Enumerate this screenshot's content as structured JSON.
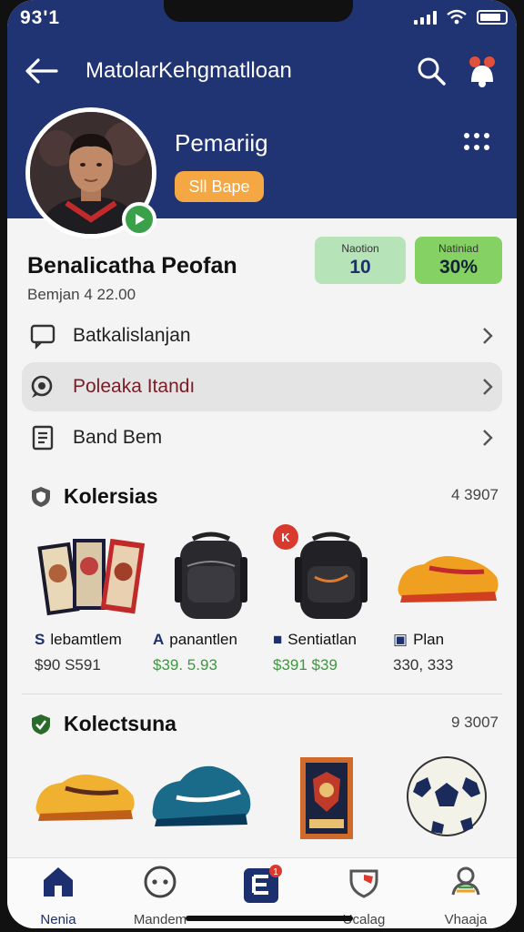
{
  "status_bar": {
    "time": "93'1"
  },
  "header": {
    "app_title": "MatolarKehgmatlloan"
  },
  "profile": {
    "role": "Pemariig",
    "badge": "Sll Bape",
    "name": "Benalicatha Peofan",
    "subtitle": "Bemjan 4 22.00",
    "stats": [
      {
        "label": "Naotion",
        "value": "10"
      },
      {
        "label": "Natiniad",
        "value": "30%"
      }
    ]
  },
  "menu": [
    {
      "label": "Batkalislanjan",
      "icon": "chat-bubble-icon"
    },
    {
      "label": "Poleaka Itandı",
      "icon": "search-chat-icon"
    },
    {
      "label": "Band Bem",
      "icon": "document-icon"
    }
  ],
  "section1": {
    "title": "Kolersias",
    "count": "4 3907",
    "items": [
      {
        "name": "lebamtlem",
        "prefix": "S",
        "price": "$90 S591",
        "price_style": "gray",
        "image": "cards"
      },
      {
        "name": "panantlen",
        "prefix": "A",
        "price": "$39. 5.93",
        "price_style": "green",
        "image": "backpack"
      },
      {
        "name": "Sentiatlan",
        "prefix": "■",
        "price": "$391 $39",
        "price_style": "green",
        "image": "backpack-orange",
        "badge": "K"
      },
      {
        "name": "Plan",
        "prefix": "▣",
        "price": "330, 333",
        "price_style": "gray",
        "image": "shoe-orange"
      }
    ]
  },
  "section2": {
    "title": "Kolectsuna",
    "count": "9 3007",
    "items": [
      {
        "image": "shoe-yellow"
      },
      {
        "image": "shoe-blue"
      },
      {
        "image": "pennant"
      },
      {
        "image": "ball"
      }
    ]
  },
  "bottom_nav": [
    {
      "label": "Nenia",
      "icon": "home-icon",
      "active": true
    },
    {
      "label": "Mandem",
      "icon": "chat-dots-icon"
    },
    {
      "label": "",
      "icon": "center-app-icon",
      "badge": "1"
    },
    {
      "label": "Ucalag",
      "icon": "shield-icon"
    },
    {
      "label": "Vhaaja",
      "icon": "profile-icon"
    }
  ],
  "colors": {
    "header_bg": "#203373",
    "accent_orange": "#f4a742",
    "accent_green": "#86d163"
  }
}
